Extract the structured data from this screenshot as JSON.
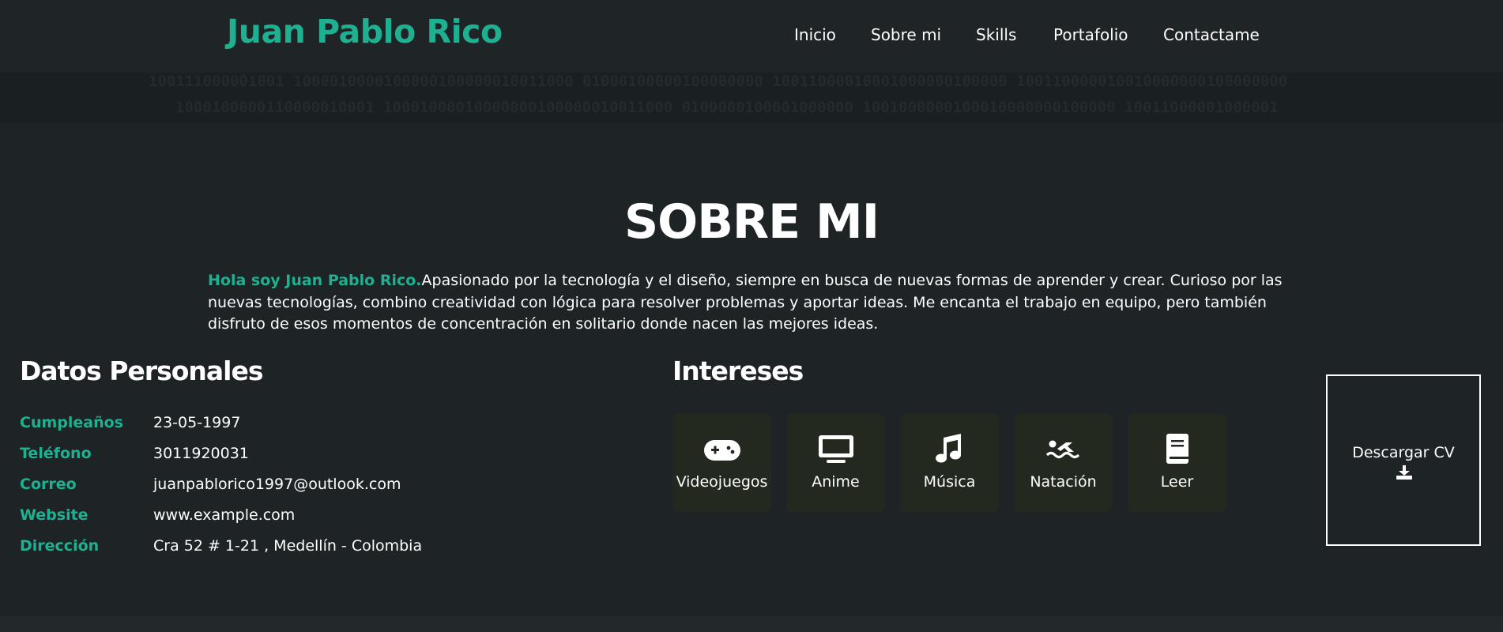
{
  "header": {
    "logo": "Juan Pablo Rico",
    "nav": [
      "Inicio",
      "Sobre mi",
      "Skills",
      "Portafolio",
      "Contactame"
    ]
  },
  "binary_banner": {
    "row1": "100111000001001  1000010000100000100000010011000  01000100000100000000 10011000010001000000100000  100110000010010000000100000000",
    "row2": "1000100000110000010001  10001000010000000100000010011000  0100000100001000000 1001000000100010000000100000 10011000001000001"
  },
  "about": {
    "title": "SOBRE MI",
    "intro_highlight": "Hola soy Juan Pablo Rico.",
    "intro_text": "Apasionado por la tecnología y el diseño, siempre en busca de nuevas formas de aprender y crear. Curioso por las nuevas tecnologías, combino creatividad con lógica para resolver problemas y aportar ideas. Me encanta el trabajo en equipo, pero también disfruto de esos momentos de concentración en solitario donde nacen las mejores ideas."
  },
  "personal": {
    "title": "Datos Personales",
    "rows": [
      {
        "label": "Cumpleaños",
        "value": "23-05-1997"
      },
      {
        "label": "Teléfono",
        "value": "3011920031"
      },
      {
        "label": "Correo",
        "value": "juanpablorico1997@outlook.com"
      },
      {
        "label": "Website",
        "value": "www.example.com"
      },
      {
        "label": "Dirección",
        "value": "Cra 52 # 1-21 , Medellín - Colombia"
      }
    ]
  },
  "interests": {
    "title": "Intereses",
    "items": [
      {
        "label": "Videojuegos",
        "icon": "gamepad-icon"
      },
      {
        "label": "Anime",
        "icon": "tv-icon"
      },
      {
        "label": "Música",
        "icon": "music-icon"
      },
      {
        "label": "Natación",
        "icon": "swimmer-icon"
      },
      {
        "label": "Leer",
        "icon": "book-icon"
      }
    ]
  },
  "cv": {
    "label": "Descargar CV",
    "icon": "download-icon"
  },
  "colors": {
    "accent": "#1eb090",
    "background": "#1e2326",
    "card": "#23291f"
  }
}
